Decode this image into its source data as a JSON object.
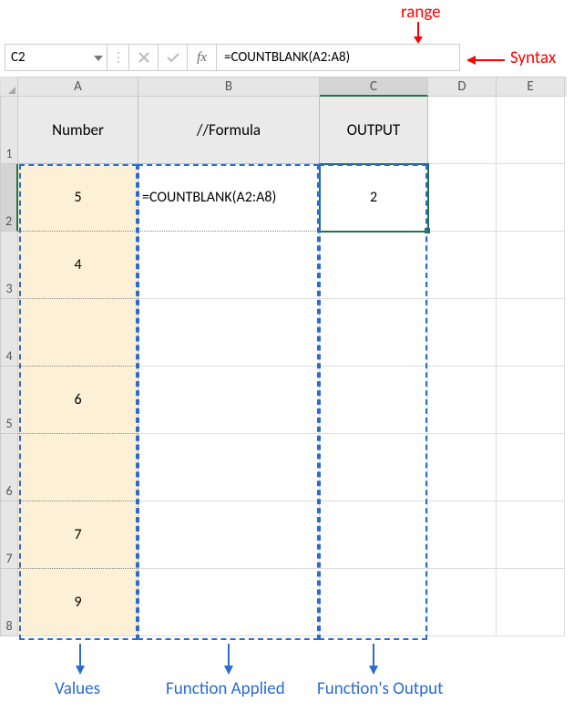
{
  "annotations": {
    "range": "range",
    "syntax": "Syntax",
    "values": "Values",
    "funcApplied": "Function Applied",
    "funcOutput": "Function's Output"
  },
  "formulabar": {
    "cellRef": "C2",
    "fx": "fx",
    "formula": "=COUNTBLANK(A2:A8)"
  },
  "columns": {
    "A": "A",
    "B": "B",
    "C": "C",
    "D": "D",
    "E": "E"
  },
  "rowNums": {
    "r1": "1",
    "r2": "2",
    "r3": "3",
    "r4": "4",
    "r5": "5",
    "r6": "6",
    "r7": "7",
    "r8": "8"
  },
  "headers": {
    "A": "Number",
    "B": "//Formula",
    "C": "OUTPUT"
  },
  "data": {
    "A2": "5",
    "A3": "4",
    "A4": "",
    "A5": "6",
    "A6": "",
    "A7": "7",
    "A8": "9",
    "B2": "=COUNTBLANK(A2:A8)",
    "C2": "2"
  }
}
